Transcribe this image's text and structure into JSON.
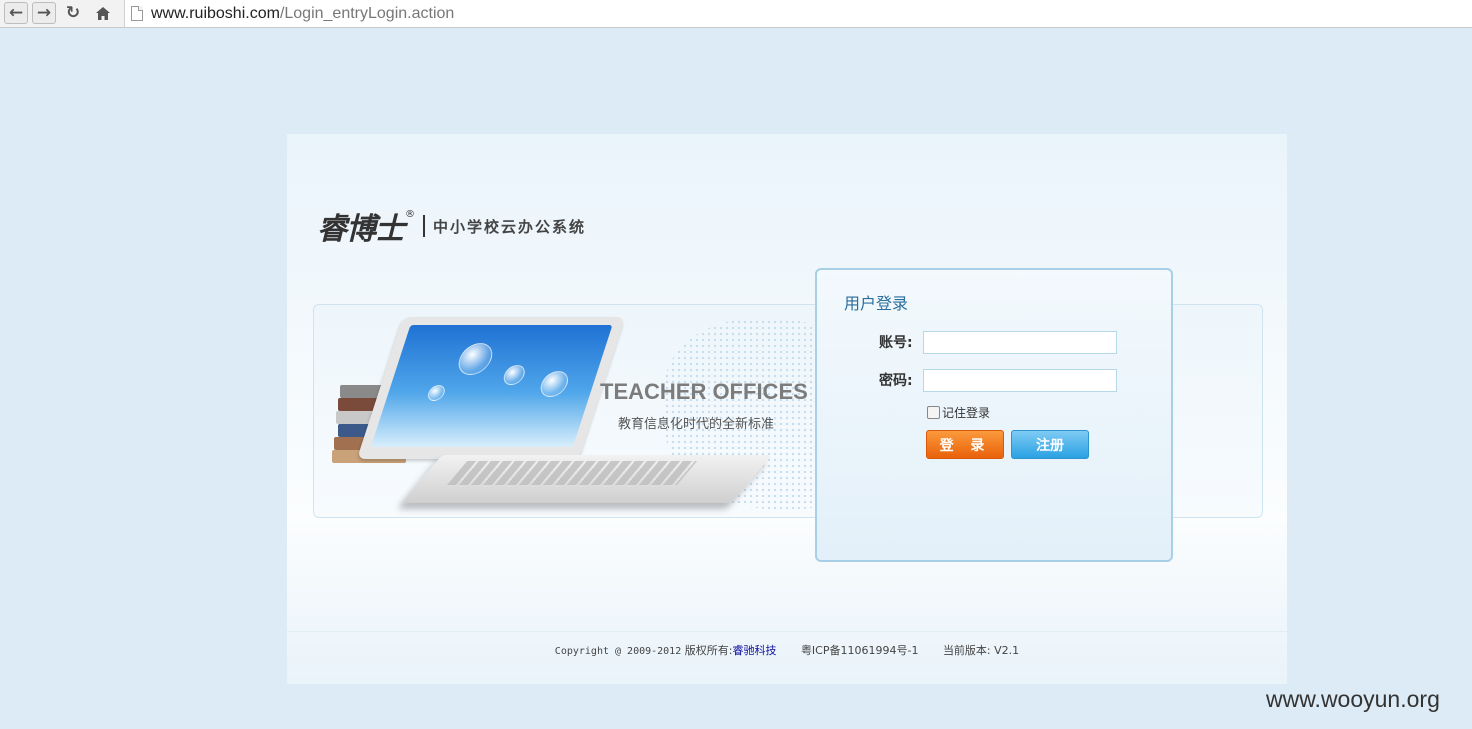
{
  "browser": {
    "url_host": "www.ruiboshi.com",
    "url_path": "/Login_entryLogin.action",
    "back_icon": "arrow-left-icon",
    "forward_icon": "arrow-right-icon",
    "reload_icon": "reload-icon",
    "home_icon": "home-icon"
  },
  "header": {
    "logo_name": "睿博士",
    "logo_reg": "®",
    "system_name": "中小学校云办公系统"
  },
  "banner": {
    "title": "TEACHER OFFICES",
    "subtitle": "教育信息化时代的全新标准"
  },
  "login": {
    "title": "用户登录",
    "account_label": "账号:",
    "account_value": "",
    "password_label": "密码:",
    "password_value": "",
    "remember_label": "记住登录",
    "remember_checked": false,
    "login_button": "登 录",
    "register_button": "注册"
  },
  "footer": {
    "copyright": "Copyright @ 2009-2012",
    "owner_label": "版权所有:",
    "owner_link": "睿驰科技",
    "icp": "粤ICP备11061994号-1",
    "version_label": "当前版本:",
    "version": "V2.1"
  },
  "watermark": "www.wooyun.org",
  "colors": {
    "page_bg": "#dcebf5",
    "login_button": "#e9610b",
    "register_button": "#2aa1e3",
    "login_title": "#2a6e9e"
  }
}
